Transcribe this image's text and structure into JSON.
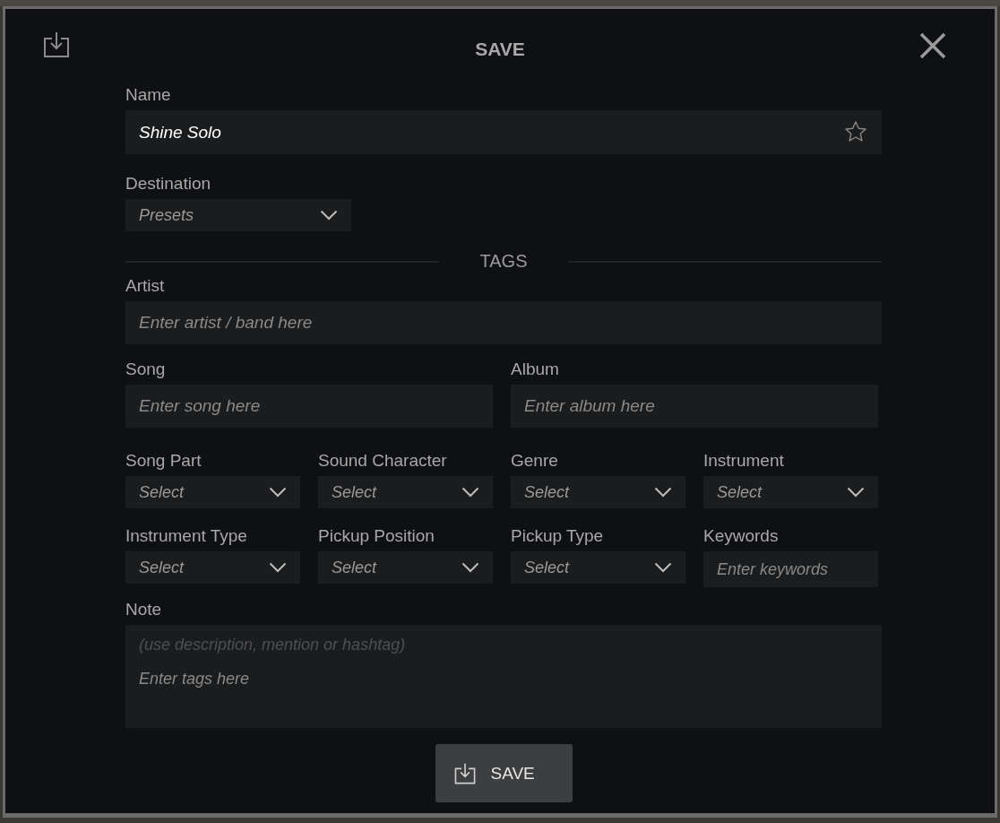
{
  "title": "SAVE",
  "name": {
    "label": "Name",
    "value": "Shine Solo",
    "favorite": false
  },
  "destination": {
    "label": "Destination",
    "value": "Presets"
  },
  "tags_heading": "TAGS",
  "artist": {
    "label": "Artist",
    "placeholder": "Enter artist / band here"
  },
  "song": {
    "label": "Song",
    "placeholder": "Enter song here"
  },
  "album": {
    "label": "Album",
    "placeholder": "Enter album here"
  },
  "tag_fields": [
    {
      "kind": "select",
      "label": "Song Part",
      "value": "Select"
    },
    {
      "kind": "select",
      "label": "Sound Character",
      "value": "Select"
    },
    {
      "kind": "select",
      "label": "Genre",
      "value": "Select"
    },
    {
      "kind": "select",
      "label": "Instrument",
      "value": "Select"
    },
    {
      "kind": "select",
      "label": "Instrument Type",
      "value": "Select"
    },
    {
      "kind": "select",
      "label": "Pickup Position",
      "value": "Select"
    },
    {
      "kind": "select",
      "label": "Pickup Type",
      "value": "Select"
    },
    {
      "kind": "text",
      "label": "Keywords",
      "placeholder": "Enter keywords"
    }
  ],
  "note": {
    "label": "Note",
    "hint": "(use description, mention or hashtag)",
    "placeholder": "Enter tags here"
  },
  "save_button": {
    "label": "SAVE"
  }
}
